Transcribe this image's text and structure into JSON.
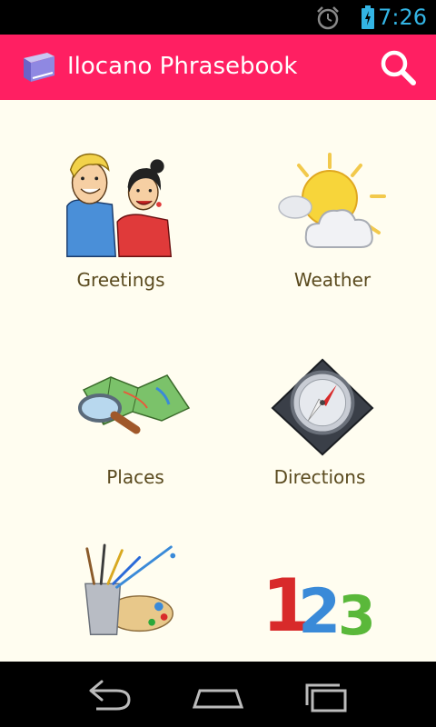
{
  "status_bar": {
    "time": "7:26",
    "time_color": "#33b5e5"
  },
  "app_bar": {
    "title": "Ilocano Phrasebook",
    "color": "#ff1f62"
  },
  "tiles": [
    {
      "label": "Greetings",
      "icon": "greetings-couple-icon"
    },
    {
      "label": "Weather",
      "icon": "sun-cloud-icon"
    },
    {
      "label": "Places",
      "icon": "map-magnifier-icon"
    },
    {
      "label": "Directions",
      "icon": "compass-icon"
    },
    {
      "label": "",
      "icon": "paint-brushes-icon"
    },
    {
      "label": "",
      "icon": "numbers-123-icon"
    }
  ],
  "navigation": {
    "back": "back-icon",
    "home": "home-icon",
    "recents": "recents-icon"
  }
}
